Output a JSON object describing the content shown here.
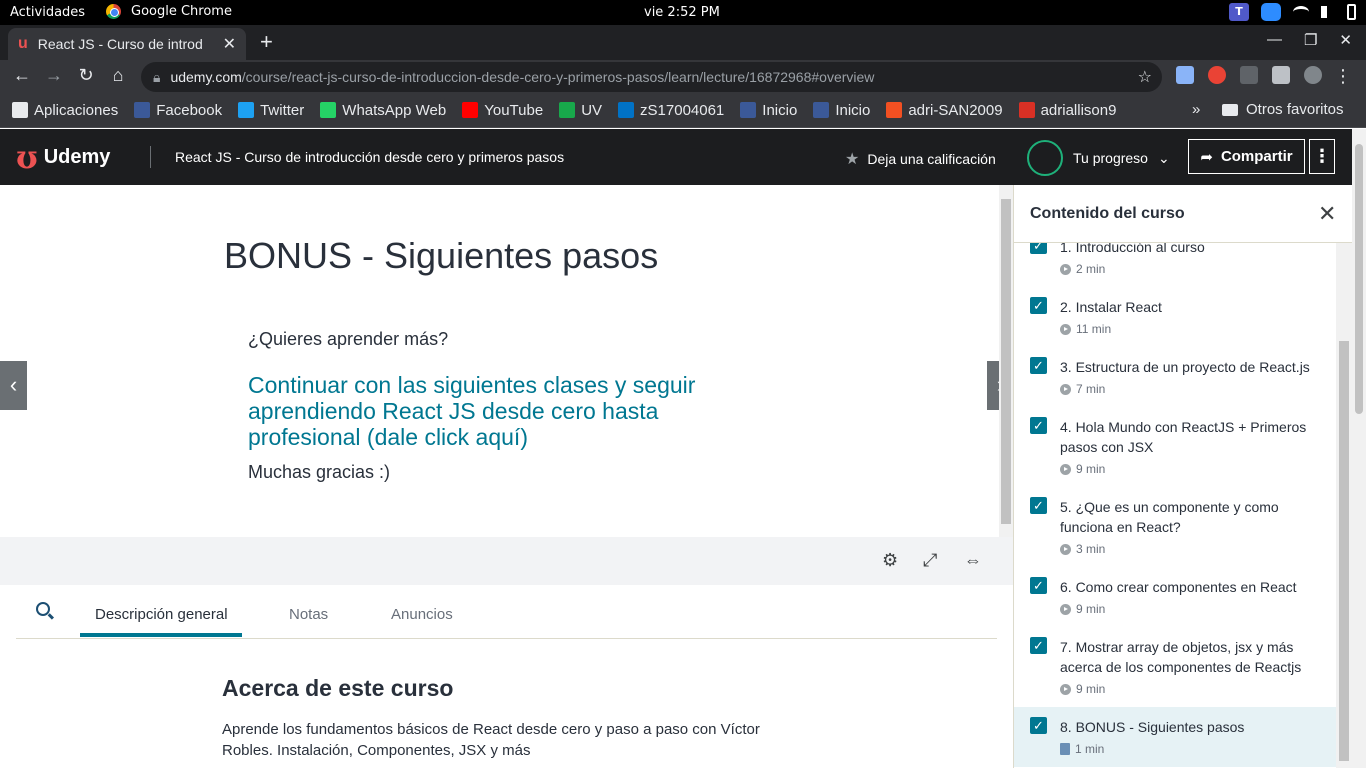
{
  "system": {
    "activities": "Actividades",
    "app_name": "Google Chrome",
    "clock": "vie  2:52 PM"
  },
  "browser": {
    "tab_title": "React JS - Curso de introd",
    "url_host": "udemy.com",
    "url_path": "/course/react-js-curso-de-introduccion-desde-cero-y-primeros-pasos/learn/lecture/16872968#overview",
    "bookmarks": [
      {
        "label": "Aplicaciones",
        "icon": "apps-grid-icon",
        "color": "#e8eaed"
      },
      {
        "label": "Facebook",
        "icon": "facebook-icon",
        "color": "#3b5998"
      },
      {
        "label": "Twitter",
        "icon": "twitter-icon",
        "color": "#1da1f2"
      },
      {
        "label": "WhatsApp Web",
        "icon": "whatsapp-icon",
        "color": "#25d366"
      },
      {
        "label": "YouTube",
        "icon": "youtube-icon",
        "color": "#ff0000"
      },
      {
        "label": "UV",
        "icon": "uv-icon",
        "color": "#18a84b"
      },
      {
        "label": "zS17004061",
        "icon": "outlook-icon",
        "color": "#0072c6"
      },
      {
        "label": "Inicio",
        "icon": "facebook-icon",
        "color": "#3b5998"
      },
      {
        "label": "Inicio",
        "icon": "facebook-icon",
        "color": "#3b5998"
      },
      {
        "label": "adri-SAN2009",
        "icon": "microsoft-icon",
        "color": "#f25022"
      },
      {
        "label": "adriallison9",
        "icon": "gmail-icon",
        "color": "#d93025"
      }
    ],
    "bookmarks_more": "»",
    "other_bookmarks": "Otros favoritos"
  },
  "udemy": {
    "brand": "Udemy",
    "course_title": "React JS - Curso de introducción desde cero y primeros pasos",
    "rate_label": "Deja una calificación",
    "progress_label": "Tu progreso",
    "share_label": "Compartir",
    "more_label": "⋮",
    "brand_color": "#ec5252",
    "accent_color": "#007791"
  },
  "lecture": {
    "title": "BONUS - Siguientes pasos",
    "question": "¿Quieres aprender más?",
    "link_text": "Continuar con las siguientes clases y seguir aprendiendo React JS desde cero hasta profesional (dale click aquí)",
    "thanks": "Muchas gracias :)",
    "prev_arrow": "‹",
    "next_arrow": "›"
  },
  "tabs": [
    {
      "label": "Descripción general",
      "active": true
    },
    {
      "label": "Notas",
      "active": false
    },
    {
      "label": "Anuncios",
      "active": false
    }
  ],
  "about": {
    "heading": "Acerca de este curso",
    "text": "Aprende los fundamentos básicos de React desde cero y paso a paso con Víctor Robles. Instalación, Componentes, JSX y más"
  },
  "sidebar": {
    "title": "Contenido del curso",
    "items": [
      {
        "title": "1. Introducción al curso",
        "duration": "2 min",
        "checked": true
      },
      {
        "title": "2. Instalar React",
        "duration": "11 min",
        "checked": true
      },
      {
        "title": "3. Estructura de un proyecto de React.js",
        "duration": "7 min",
        "checked": true
      },
      {
        "title": "4. Hola Mundo con ReactJS + Primeros pasos con JSX",
        "duration": "9 min",
        "checked": true
      },
      {
        "title": "5. ¿Que es un componente y como funciona en React?",
        "duration": "3 min",
        "checked": true
      },
      {
        "title": "6. Como crear componentes en React",
        "duration": "9 min",
        "checked": true
      },
      {
        "title": "7. Mostrar array de objetos, jsx y más acerca de los componentes de Reactjs",
        "duration": "9 min",
        "checked": true
      },
      {
        "title": "8. BONUS - Siguientes pasos",
        "duration": "1 min",
        "checked": true,
        "active": true
      }
    ]
  }
}
